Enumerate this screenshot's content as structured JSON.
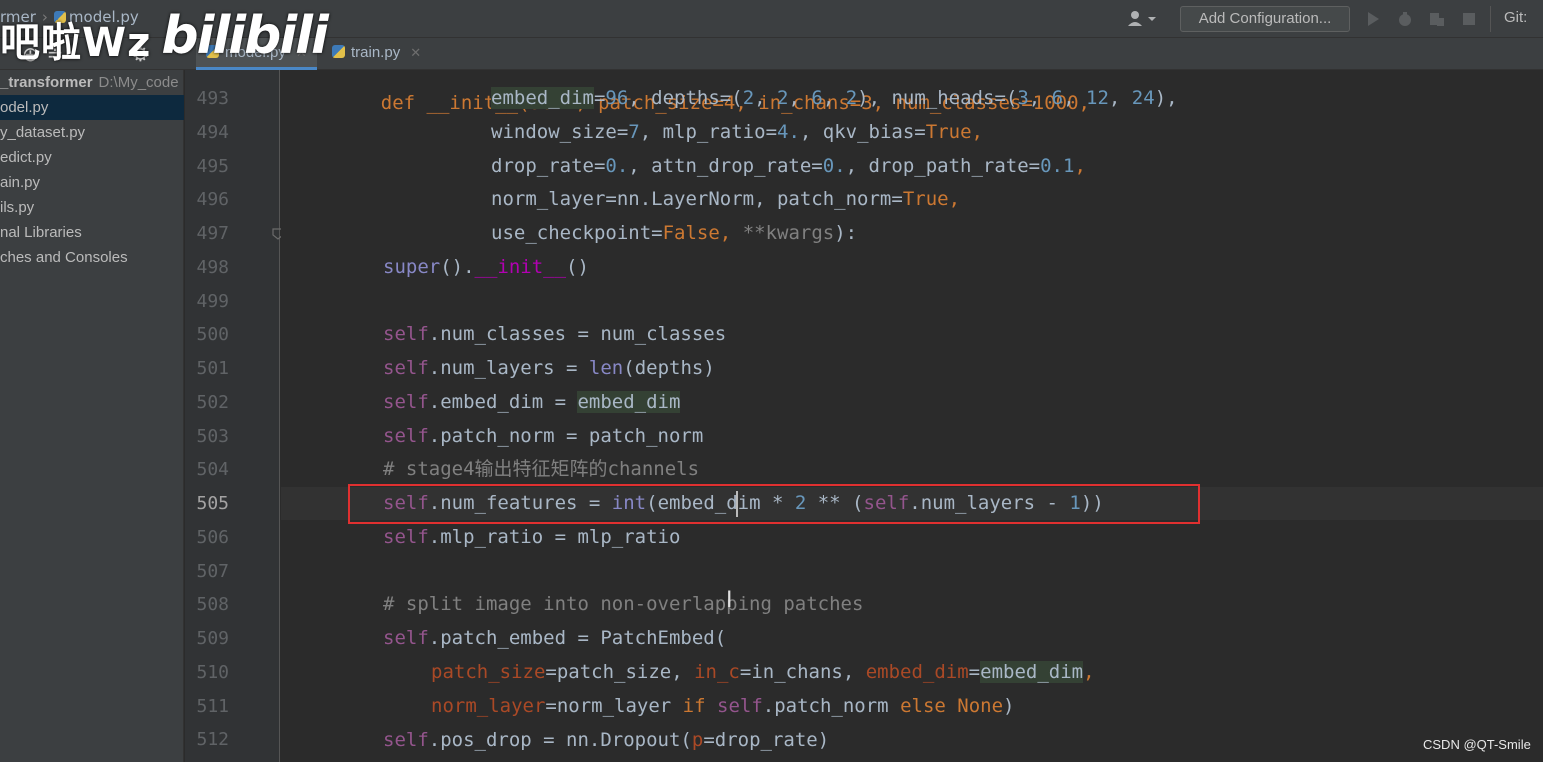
{
  "breadcrumb": {
    "project": "rmer",
    "file": "model.py"
  },
  "watermark": {
    "text": "吧啦Wz",
    "logo": "bilibili"
  },
  "toolbar": {
    "add_config_label": "Add Configuration...",
    "git_label": "Git:"
  },
  "tabs": [
    {
      "label": "model.py",
      "active": true
    },
    {
      "label": "train.py",
      "active": false
    }
  ],
  "project_panel": {
    "items": [
      {
        "label": "_transformer",
        "path": "D:\\My_code",
        "root": true,
        "selected": false
      },
      {
        "label": "odel.py",
        "selected": true
      },
      {
        "label": "y_dataset.py",
        "selected": false
      },
      {
        "label": "edict.py",
        "selected": false
      },
      {
        "label": "ain.py",
        "selected": false
      },
      {
        "label": "ils.py",
        "selected": false
      },
      {
        "label": "nal Libraries",
        "selected": false
      },
      {
        "label": "ches and Consoles",
        "selected": false
      }
    ]
  },
  "editor": {
    "current_line": "505",
    "lines": [
      {
        "num": "493"
      },
      {
        "num": "494"
      },
      {
        "num": "495"
      },
      {
        "num": "496"
      },
      {
        "num": "497"
      },
      {
        "num": "498"
      },
      {
        "num": "499"
      },
      {
        "num": "500"
      },
      {
        "num": "501"
      },
      {
        "num": "502"
      },
      {
        "num": "503"
      },
      {
        "num": "504"
      },
      {
        "num": "505"
      },
      {
        "num": "506"
      },
      {
        "num": "507"
      },
      {
        "num": "508"
      },
      {
        "num": "509"
      },
      {
        "num": "510"
      },
      {
        "num": "511"
      },
      {
        "num": "512"
      }
    ],
    "code": {
      "l492": "def __init__(self, patch_size=4, in_chans=3, num_classes=1000,",
      "l493": {
        "a": "embed_dim",
        "b": "=",
        "c": "96",
        "d": ", depths=(",
        "e": "2",
        "f": ", ",
        "g": "2",
        "h": ", ",
        "i": "6",
        "j": ", ",
        "k": "2",
        "l": "), num_heads=(",
        "m": "3",
        "n": ", ",
        "o": "6",
        "p": ", ",
        "q": "12",
        "r": ", ",
        "s": "24",
        "t": "),"
      },
      "l494": {
        "a": "window_size=",
        "b": "7",
        "c": ", mlp_ratio=",
        "d": "4.",
        "e": ", qkv_bias=",
        "f": "True",
        "g": ","
      },
      "l495": {
        "a": "drop_rate=",
        "b": "0.",
        "c": ", attn_drop_rate=",
        "d": "0.",
        "e": ", drop_path_rate=",
        "f": "0.1",
        "g": ","
      },
      "l496": {
        "a": "norm_layer=nn.LayerNorm, patch_norm=",
        "b": "True",
        "c": ","
      },
      "l497": {
        "a": "use_checkpoint=",
        "b": "False",
        "c": ", ",
        "d": "**kwargs",
        "e": "):"
      },
      "l498": {
        "a": "super",
        "b": "().",
        "c": "__init__",
        "d": "()"
      },
      "l500": {
        "a": "self",
        "b": ".num_classes = num_classes"
      },
      "l501": {
        "a": "self",
        "b": ".num_layers = ",
        "c": "len",
        "d": "(depths)"
      },
      "l502": {
        "a": "self",
        "b": ".embed_dim = ",
        "c": "embed_dim"
      },
      "l503": {
        "a": "self",
        "b": ".patch_norm = patch_norm"
      },
      "l504": "# stage4输出特征矩阵的channels",
      "l505": {
        "a": "self",
        "b": ".num_features = ",
        "c": "int",
        "d": "(embed_dim * ",
        "e": "2",
        "f": " ** (",
        "g": "self",
        "h": ".num_layers - ",
        "i": "1",
        "j": "))"
      },
      "l506": {
        "a": "self",
        "b": ".mlp_ratio = mlp_ratio"
      },
      "l508": "# split image into non-overlapping patches",
      "l509": {
        "a": "self",
        "b": ".patch_embed = PatchEmbed("
      },
      "l510": {
        "a": "patch_size",
        "b": "=patch_size, ",
        "c": "in_c",
        "d": "=in_chans, ",
        "e": "embed_dim",
        "f": "=",
        "g": "embed_dim",
        "h": ","
      },
      "l511": {
        "a": "norm_layer",
        "b": "=norm_layer ",
        "c": "if",
        "d": " ",
        "e": "self",
        "f": ".patch_norm ",
        "g": "else",
        "h": " ",
        "i": "None",
        "j": ")"
      },
      "l512": {
        "a": "self",
        "b": ".pos_drop = nn.Dropout(",
        "c": "p",
        "d": "=drop_rate)"
      }
    }
  },
  "footer_watermark": "CSDN @QT-Smile"
}
